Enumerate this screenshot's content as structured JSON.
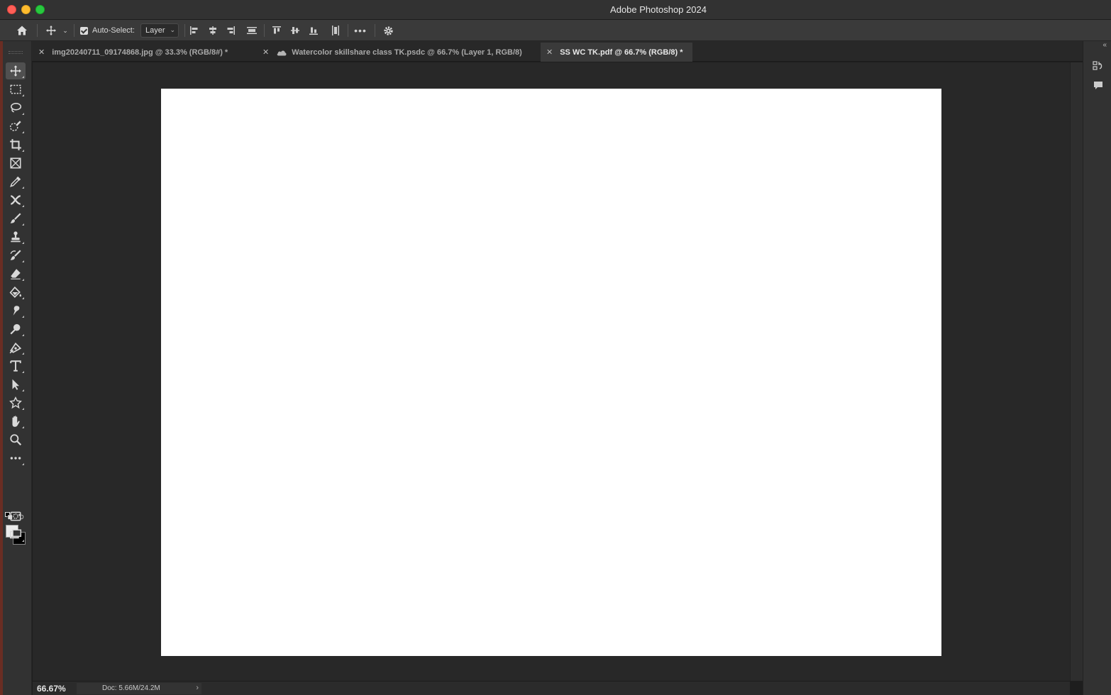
{
  "window": {
    "title": "Adobe Photoshop 2024"
  },
  "options_bar": {
    "auto_select_label": "Auto-Select:",
    "auto_select_checked": true,
    "target_select_value": "Layer"
  },
  "tabs": [
    {
      "label": "img20240711_09174868.jpg @ 33.3% (RGB/8#) *",
      "active": false,
      "cloud": false
    },
    {
      "label": "Watercolor skillshare class TK.psdc @ 66.7% (Layer 1, RGB/8)",
      "active": false,
      "cloud": true
    },
    {
      "label": "SS WC TK.pdf @ 66.7% (RGB/8) *",
      "active": true,
      "cloud": false
    }
  ],
  "tools": [
    "move-tool-icon",
    "rectangular-marquee-icon",
    "lasso-icon",
    "quick-selection-icon",
    "crop-icon",
    "frame-icon",
    "eyedropper-icon",
    "healing-brush-icon",
    "brush-icon",
    "clone-stamp-icon",
    "history-brush-icon",
    "eraser-icon",
    "paint-bucket-icon",
    "smudge-icon",
    "dodge-icon",
    "pen-icon",
    "type-icon",
    "path-selection-icon",
    "custom-shape-icon",
    "hand-icon",
    "zoom-icon",
    "more-tools-icon"
  ],
  "colors": {
    "foreground": "#ececec",
    "background": "#000000"
  },
  "status": {
    "zoom": "66.67%",
    "doc_info": "Doc: 5.66M/24.2M"
  }
}
